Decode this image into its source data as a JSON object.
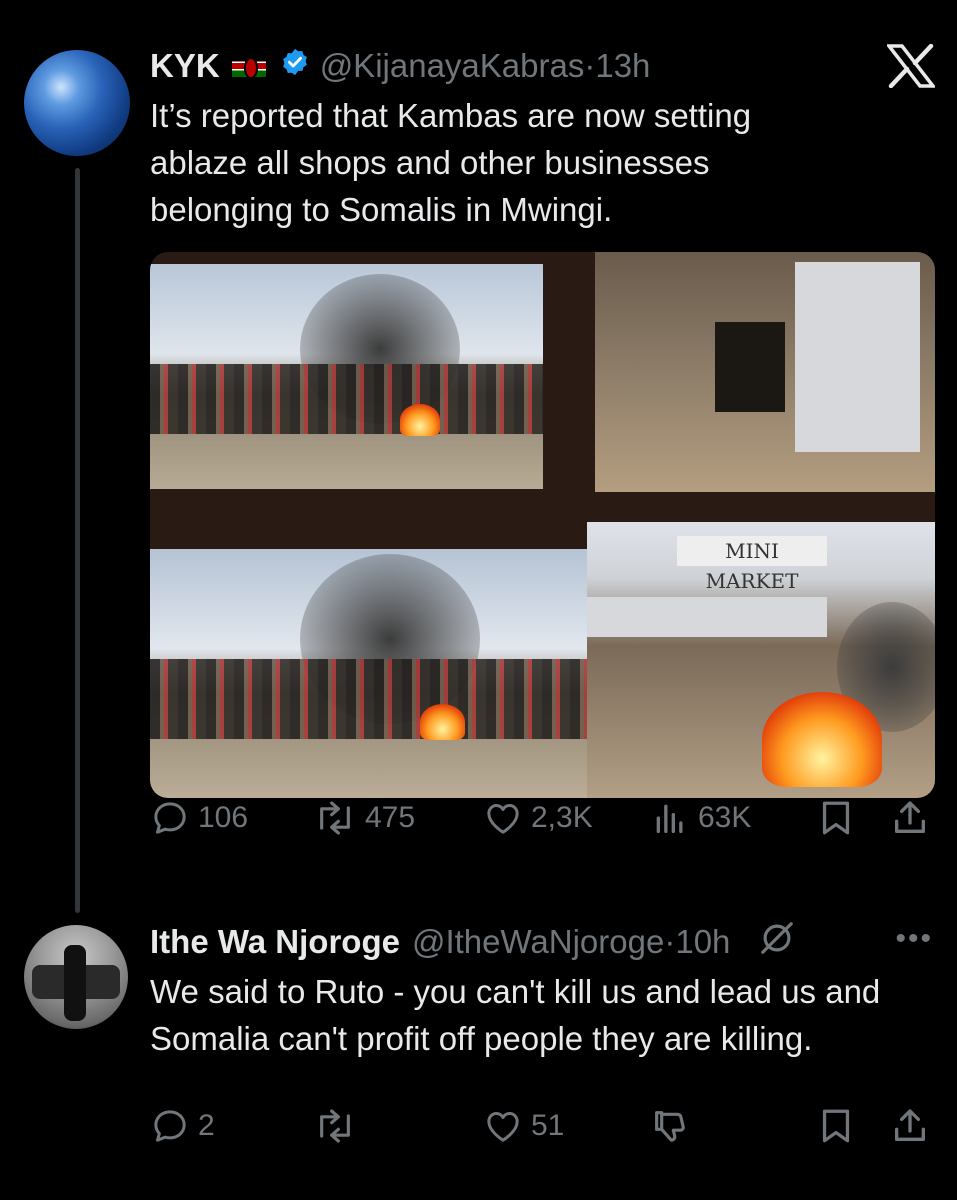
{
  "tweet_main": {
    "name": "KYK",
    "handle": "@KijanayaKabras",
    "dot": "·",
    "time": "13h",
    "text": "It’s reported that Kambas are now setting ablaze all shops and other businesses belonging to Somalis in Mwingi.",
    "media_sign": "MINI MARKET",
    "actions": {
      "replies": "106",
      "retweets": "475",
      "likes": "2,3K",
      "views": "63K"
    }
  },
  "tweet_reply": {
    "name": "Ithe Wa Njoroge",
    "handle": "@ItheWaNjoroge",
    "dot": "·",
    "time": "10h",
    "text": "We said to Ruto - you can't kill us and lead us and Somalia can't profit off people they are killing.",
    "actions": {
      "replies": "2",
      "likes": "51"
    }
  },
  "icons": {
    "logo": "x-logo-icon",
    "verified": "verified-badge-icon",
    "flag": "kenya-flag-icon",
    "reply": "reply-icon",
    "retweet": "retweet-icon",
    "like": "heart-icon",
    "views": "views-icon",
    "bookmark": "bookmark-icon",
    "share": "share-icon",
    "dislike": "dislike-icon",
    "mute": "mute-icon",
    "more": "more-icon"
  },
  "colors": {
    "background": "#000000",
    "text": "#e7e9ea",
    "muted": "#71767b",
    "verified": "#1d9bf0"
  }
}
